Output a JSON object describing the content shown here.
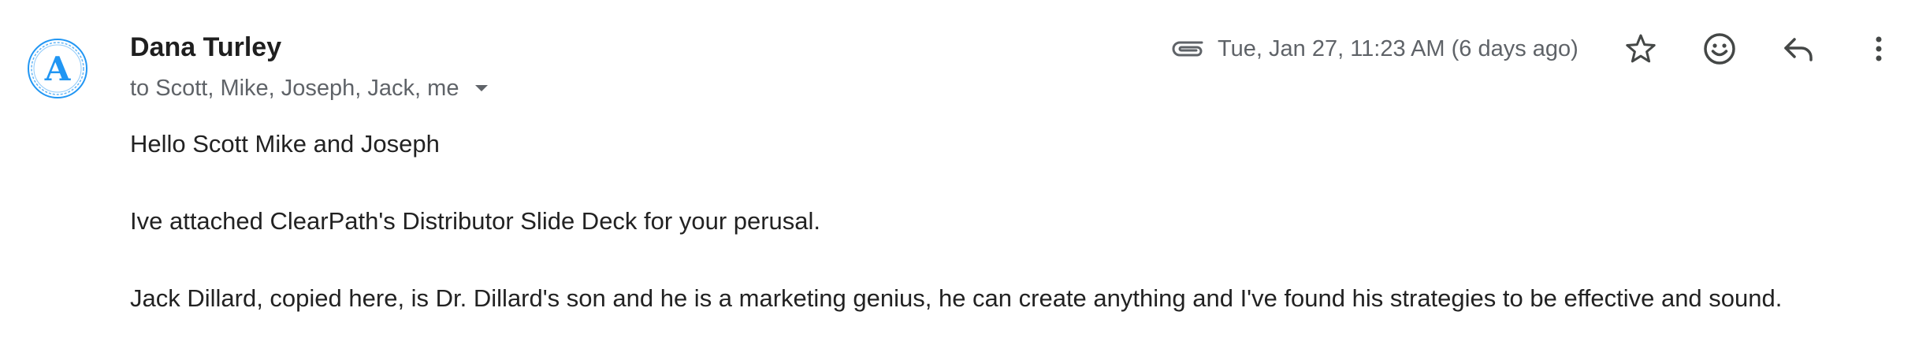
{
  "email": {
    "sender_name": "Dana Turley",
    "recipients_text": "to Scott, Mike, Joseph, Jack, me",
    "date_text": "Tue, Jan 27, 11:23 AM (6 days ago)",
    "avatar_letter": "A",
    "avatar_color": "#2196f3"
  },
  "body": {
    "paragraphs": [
      "Hello Scott Mike and Joseph",
      "Ive attached ClearPath's Distributor Slide Deck for your perusal.",
      "Jack Dillard, copied here, is Dr. Dillard's son and he is a marketing genius, he can create anything and I've found his strategies to be effective and sound."
    ]
  },
  "toolbar": {
    "icons": [
      "attachment-icon",
      "star-icon",
      "emoji-icon",
      "reply-icon",
      "more-vert-icon"
    ]
  }
}
